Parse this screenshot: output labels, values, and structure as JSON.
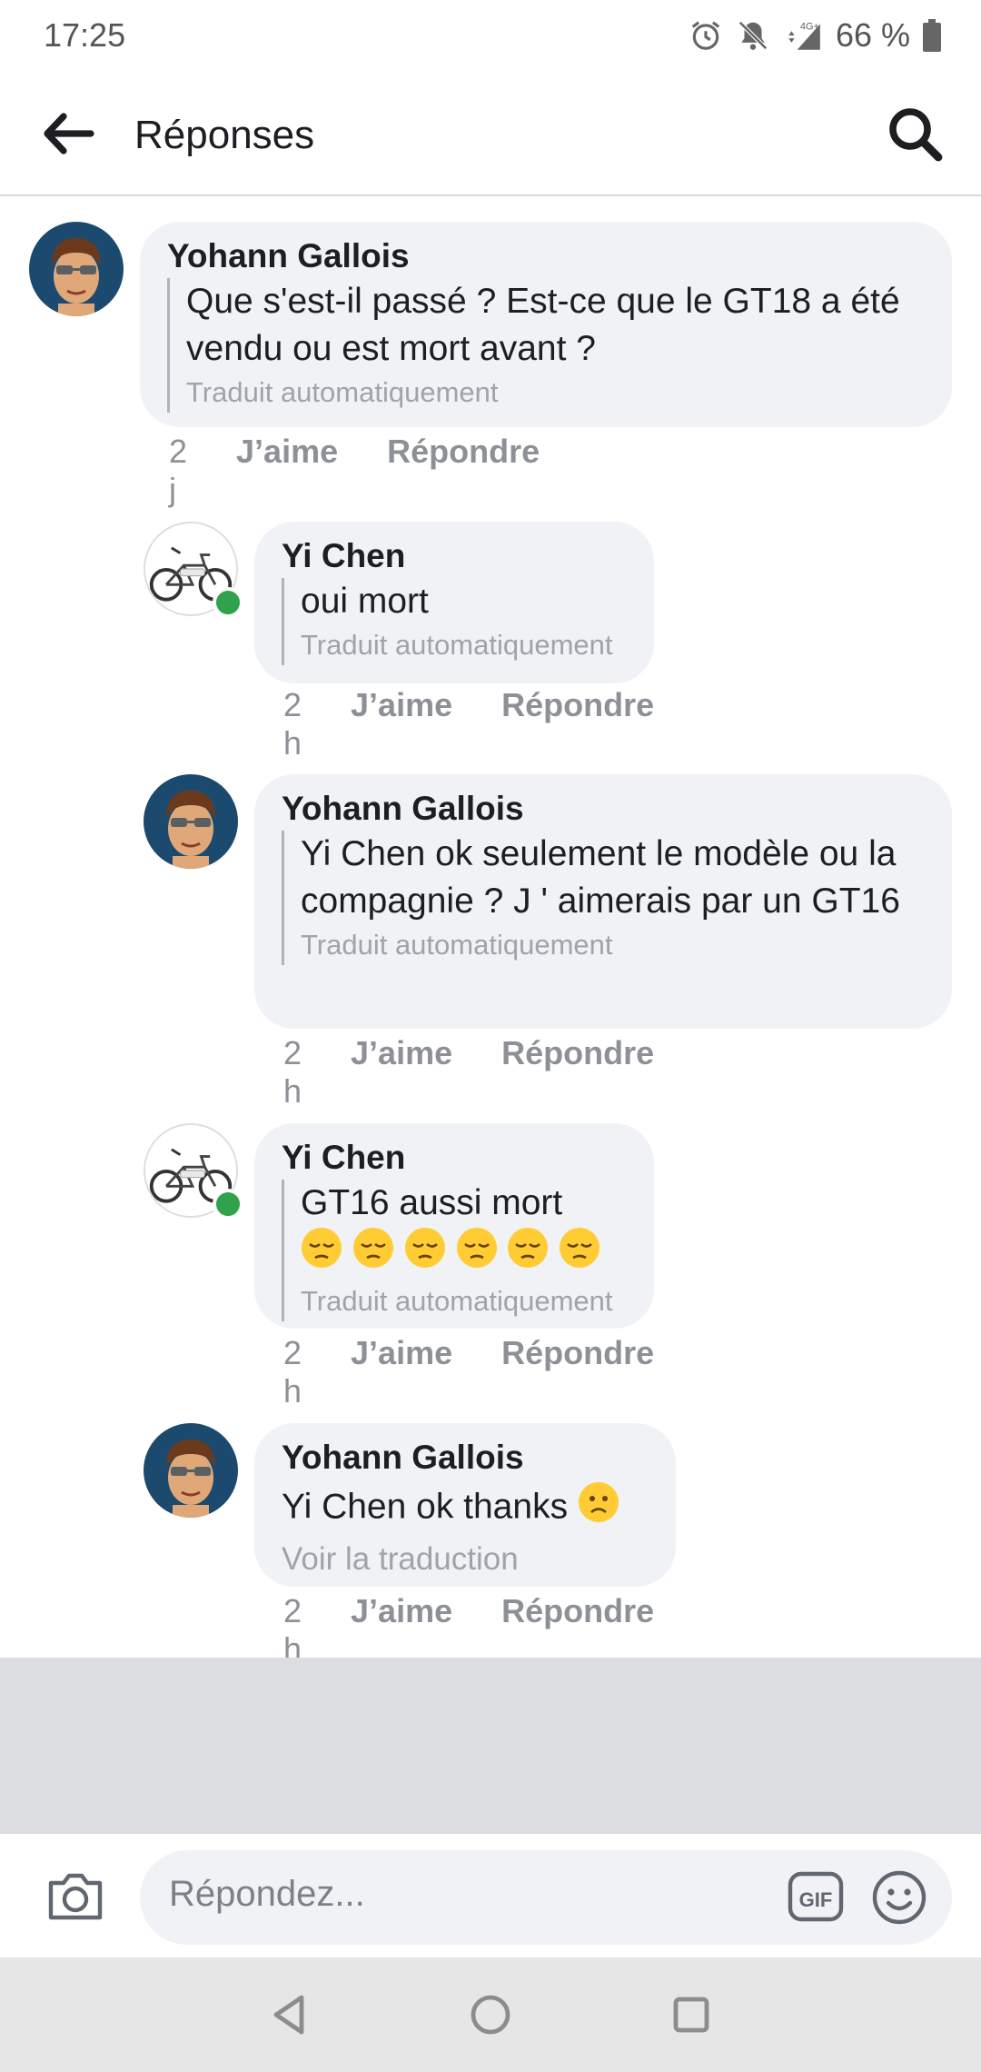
{
  "status_bar": {
    "time": "17:25",
    "battery": "66 %",
    "network": "4G+"
  },
  "header": {
    "title": "Réponses",
    "back_icon": "arrow-left-icon",
    "search_icon": "search-icon"
  },
  "comments": [
    {
      "author": "Yohann Gallois",
      "text": "Que s'est-il passé ? Est-ce que le GT18 a été vendu ou est mort avant ?",
      "translation_note": "Traduit automatiquement",
      "time": "2 j",
      "like": "J’aime",
      "reply": "Répondre",
      "online": false
    },
    {
      "author": "Yi Chen",
      "text": "oui mort",
      "translation_note": "Traduit automatiquement",
      "time": "2 h",
      "like": "J’aime",
      "reply": "Répondre",
      "online": true
    },
    {
      "author": "Yohann Gallois",
      "text": "Yi Chen ok seulement le modèle ou la compagnie ? J ' aimerais par un GT16",
      "translation_note": "Traduit automatiquement",
      "time": "2 h",
      "like": "J’aime",
      "reply": "Répondre",
      "online": false
    },
    {
      "author": "Yi Chen",
      "text": "GT16 aussi mort",
      "emoji_icon": "pensive-face-icon",
      "emoji_count": 6,
      "translation_note": "Traduit automatiquement",
      "time": "2 h",
      "like": "J’aime",
      "reply": "Répondre",
      "online": true
    },
    {
      "author": "Yohann Gallois",
      "text": "Yi Chen ok thanks",
      "emoji_icon": "frowning-face-icon",
      "see_translation": "Voir la traduction",
      "time": "2 h",
      "like": "J’aime",
      "reply": "Répondre",
      "online": false
    }
  ],
  "composer": {
    "placeholder": "Répondez...",
    "gif_label": "GIF"
  },
  "colors": {
    "bubble": "#f0f2f5",
    "online": "#31a24c",
    "avatar_bg": "#1b4a6e",
    "meta_text": "#8d9197"
  }
}
